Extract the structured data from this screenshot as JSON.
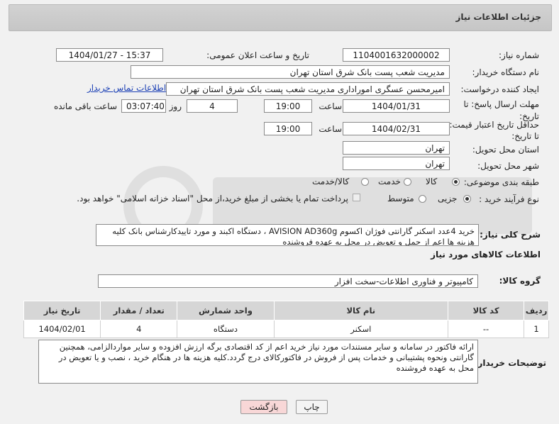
{
  "header": {
    "title": "جزئیات اطلاعات نیاز"
  },
  "fields": {
    "need_number_label": "شماره نیاز:",
    "need_number": "1104001632000002",
    "announce_label": "تاریخ و ساعت اعلان عمومی:",
    "announce_value": "1404/01/27 - 15:37",
    "buyer_org_label": "نام دستگاه خریدار:",
    "buyer_org": "مدیریت شعب پست بانک شرق استان تهران",
    "requester_label": "ایجاد کننده درخواست:",
    "requester": "امیرمحسن عسگری اموراداری مدیریت شعب پست بانک شرق استان تهران",
    "contact_link": "اطلاعات تماس خریدار",
    "deadline_label": "مهلت ارسال پاسخ: تا تاریخ:",
    "deadline_date": "1404/01/31",
    "hour_label": "ساعت",
    "deadline_time": "19:00",
    "days_value": "4",
    "days_label": "روز و",
    "remaining_time": "03:07:40",
    "remaining_label": "ساعت باقی مانده",
    "validity_label": "حداقل تاریخ اعتبار قیمت: تا تاریخ:",
    "validity_date": "1404/02/31",
    "validity_hour_label": "ساعت",
    "validity_time": "19:00",
    "province_label": "استان محل تحویل:",
    "province": "تهران",
    "city_label": "شهر محل تحویل:",
    "city": "تهران",
    "category_label": "طبقه بندی موضوعی:",
    "category_options": [
      "کالا",
      "خدمت",
      "کالا/خدمت"
    ],
    "process_label": "نوع فرآیند خرید :",
    "process_options": [
      "جزیی",
      "متوسط"
    ],
    "payment_note": "پرداخت تمام یا بخشی از مبلغ خرید،از محل \"اسناد خزانه اسلامی\" خواهد بود."
  },
  "summary": {
    "label": "شرح کلی نیاز:",
    "text": "خرید 4عدد  اسکنر گارانتی فوژان اکسوم AVISION AD360g  ، دستگاه اکبند و مورد تاییدکارشناس بانک کلیه هزینه ها اعم از حمل و تعویض در محل به عهده فروشنده"
  },
  "goods": {
    "section_title": "اطلاعات کالاهای مورد نیاز",
    "group_label": "گروه کالا:",
    "group_value": "کامپیوتر و فناوری اطلاعات-سخت افزار",
    "columns": [
      "ردیف",
      "کد کالا",
      "نام کالا",
      "واحد شمارش",
      "تعداد / مقدار",
      "تاریخ نیاز"
    ],
    "rows": [
      {
        "row": "1",
        "code": "--",
        "name": "اسکنر",
        "unit": "دستگاه",
        "qty": "4",
        "date": "1404/02/01"
      }
    ]
  },
  "buyer_notes": {
    "label": "توضیحات خریدار:",
    "text": "ارائه فاکتور در سامانه و سایر مستندات مورد نیاز خرید اعم از کد اقتصادی  برگه ارزش افزوده و سایر مواردالزامی، همچنین گارانتی ونحوه پشتیبانی و خدمات پس از فروش در فاکتورکالای درج گردد.کلیه هزینه ها در هنگام خرید ، نصب و یا تعویض در محل به عهده فروشنده"
  },
  "buttons": {
    "print": "چاپ",
    "back": "بازگشت"
  },
  "colors": {
    "link": "#1a3fb5",
    "back_button_bg": "#f8d7d7",
    "header_bg": "#cbcbcb"
  }
}
